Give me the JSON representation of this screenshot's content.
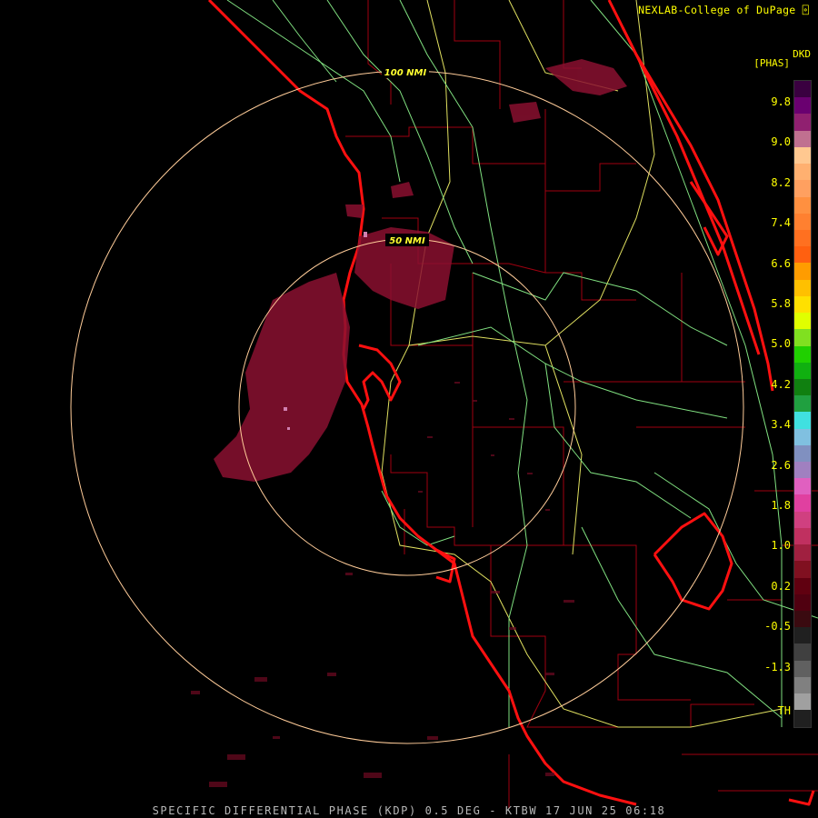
{
  "credit": "NEXLAB-College of DuPage",
  "credit_icon": "cod-logo-icon",
  "footer": "SPECIFIC DIFFERENTIAL PHASE (KDP) 0.5 DEG - KTBW 17 JUN 25 06:18",
  "legend": {
    "product": "DKD",
    "unit": "[PHAS]",
    "labels": [
      "9.8",
      "9.0",
      "8.2",
      "7.4",
      "6.6",
      "5.8",
      "5.0",
      "4.2",
      "3.4",
      "2.6",
      "1.8",
      "1.0",
      "0.2",
      "-0.5",
      "-1.3",
      "TH"
    ],
    "colors": [
      "#3a0040",
      "#6a0070",
      "#902070",
      "#c07090",
      "#ffc890",
      "#ffb070",
      "#ffa060",
      "#ff9040",
      "#ff8030",
      "#ff7020",
      "#ff6010",
      "#ff9c00",
      "#ffc000",
      "#ffe000",
      "#e0ff00",
      "#80e020",
      "#20d000",
      "#10b010",
      "#108010",
      "#20a040",
      "#40e0e0",
      "#80c0e0",
      "#8090c0",
      "#a080c0",
      "#e060c0",
      "#e040a0",
      "#d04080",
      "#c03060",
      "#a02040",
      "#801020",
      "#600010",
      "#500010",
      "#3a0a10",
      "#202020",
      "#404040",
      "#606060",
      "#808080",
      "#a0a0a0",
      "#202020"
    ]
  },
  "range_rings": {
    "inner": "50 NMI",
    "outer": "100 NMI"
  },
  "colors": {
    "coastline": "#ff1010",
    "county": "#a00010",
    "highway": "#e0e060",
    "road": "#80e080",
    "ring": "#ffcc99",
    "echo": "#8a1030"
  }
}
